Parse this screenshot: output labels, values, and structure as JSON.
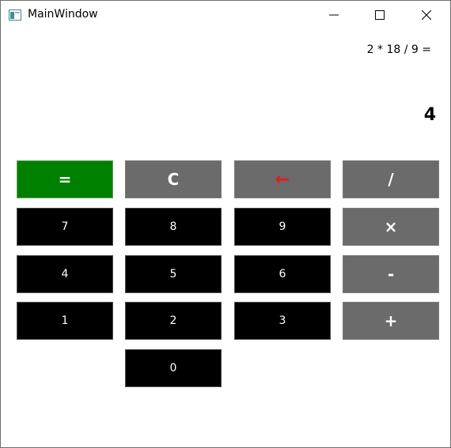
{
  "window": {
    "title": "MainWindow",
    "app_icon": "window-app-icon",
    "controls": {
      "minimize_icon": "minimize-icon",
      "maximize_icon": "maximize-icon",
      "close_icon": "close-icon"
    }
  },
  "display": {
    "expression": "2 * 18 / 9 =",
    "result": "4"
  },
  "keys": {
    "equals": "=",
    "clear": "C",
    "backspace": "←",
    "divide": "/",
    "seven": "7",
    "eight": "8",
    "nine": "9",
    "multiply": "×",
    "four": "4",
    "five": "5",
    "six": "6",
    "subtract": "-",
    "one": "1",
    "two": "2",
    "three": "3",
    "add": "+",
    "zero": "0"
  },
  "colors": {
    "equals_bg": "#008000",
    "operator_bg": "#6b6b6b",
    "digit_bg": "#000000",
    "backspace_fg": "#e8161b"
  }
}
